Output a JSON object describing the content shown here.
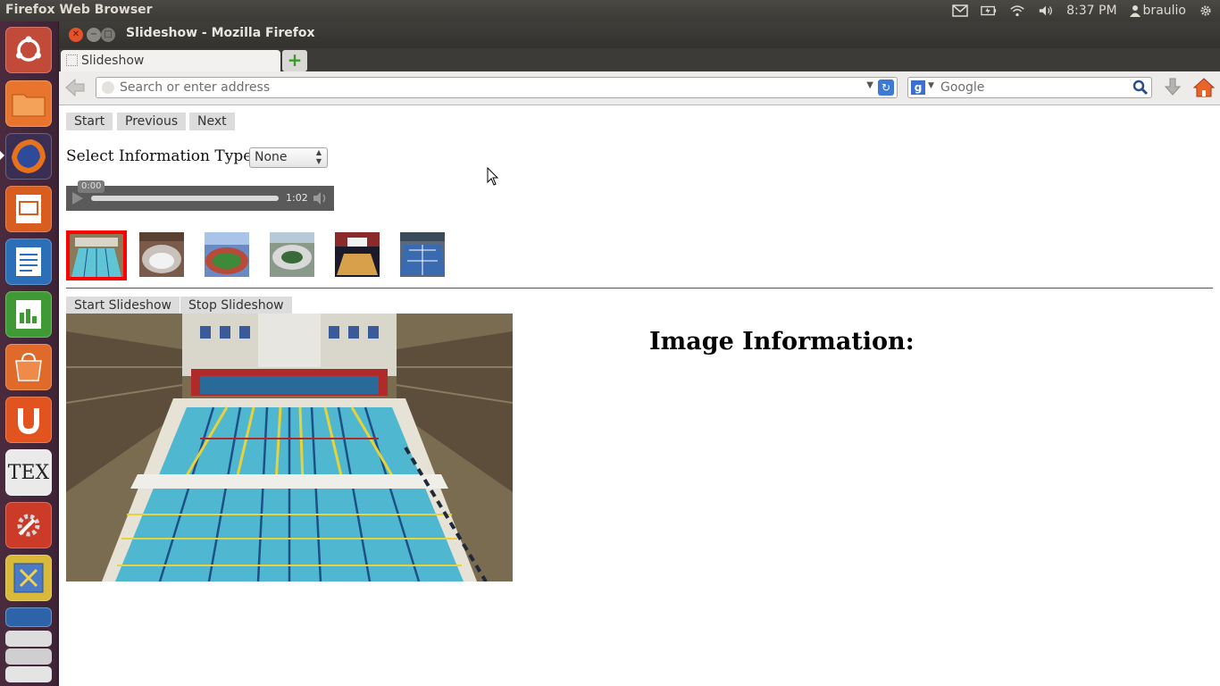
{
  "top_panel": {
    "app_title": "Firefox Web Browser",
    "clock": "8:37 PM",
    "user": "braulio",
    "icons": [
      "mail-icon",
      "battery-icon",
      "wifi-icon",
      "volume-icon",
      "user-icon",
      "gear-icon"
    ]
  },
  "launcher": {
    "items": [
      {
        "name": "ubuntu-dash-icon",
        "color": "#c24a39"
      },
      {
        "name": "files-icon",
        "color": "#e8742d"
      },
      {
        "name": "firefox-icon",
        "color": "#e0731f"
      },
      {
        "name": "impress-icon",
        "color": "#d85d1f"
      },
      {
        "name": "writer-icon",
        "color": "#2a6fb8"
      },
      {
        "name": "calc-icon",
        "color": "#3f9a36"
      },
      {
        "name": "software-center-icon",
        "color": "#e06a2a"
      },
      {
        "name": "ubuntu-one-icon",
        "color": "#e1541f"
      },
      {
        "name": "tex-icon",
        "color": "#eaeaea"
      },
      {
        "name": "settings-icon",
        "color": "#cc3a28"
      },
      {
        "name": "workspaces-icon",
        "color": "#d8b93a"
      }
    ],
    "tex_label": "TEX"
  },
  "window": {
    "title": "Slideshow - Mozilla Firefox",
    "tab_label": "Slideshow",
    "new_tab_symbol": "+",
    "url_placeholder": "Search or enter address",
    "search_placeholder": "Google",
    "search_engine_letter": "g"
  },
  "page": {
    "nav": {
      "start": "Start",
      "previous": "Previous",
      "next": "Next"
    },
    "select_label": "Select Information Type:",
    "select_value": "None",
    "audio": {
      "current": "0:00",
      "duration": "1:02"
    },
    "thumbnails": [
      {
        "name": "thumb-pool",
        "selected": true
      },
      {
        "name": "thumb-arena"
      },
      {
        "name": "thumb-stadium"
      },
      {
        "name": "thumb-dome"
      },
      {
        "name": "thumb-court"
      },
      {
        "name": "thumb-tennis"
      }
    ],
    "slideshow": {
      "start": "Start Slideshow",
      "stop": "Stop Slideshow"
    },
    "info_heading": "Image Information:"
  },
  "colors": {
    "selected_thumb_border": "#ff0000"
  }
}
